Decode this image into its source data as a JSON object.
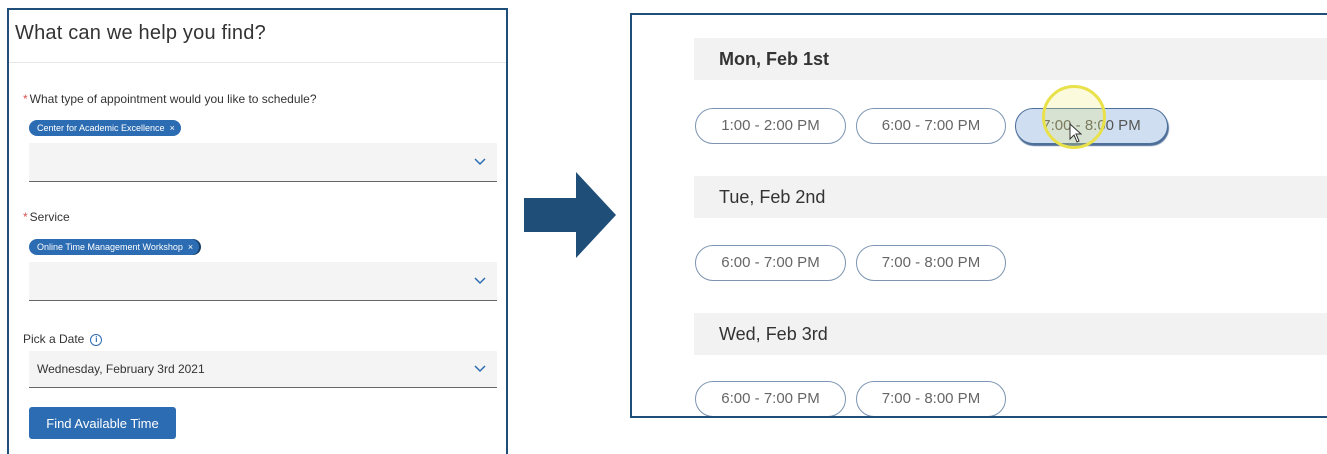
{
  "form": {
    "title": "What can we help you find?",
    "appointment_label": "What type of appointment would you like to schedule?",
    "appointment_chip": "Center for Academic Excellence",
    "service_label": "Service",
    "service_chip": "Online Time Management Workshop",
    "chip_remove": "×",
    "required_marker": "*",
    "date_label": "Pick a Date",
    "date_info_icon": "i",
    "date_value": "Wednesday, February 3rd 2021",
    "find_button": "Find Available Time"
  },
  "schedule": {
    "days": [
      {
        "label": "Mon, Feb 1st",
        "slots": [
          "1:00 - 2:00 PM",
          "6:00 - 7:00 PM",
          "7:00 - 8:00 PM"
        ]
      },
      {
        "label": "Tue, Feb 2nd",
        "slots": [
          "6:00 - 7:00 PM",
          "7:00 - 8:00 PM"
        ]
      },
      {
        "label": "Wed, Feb 3rd",
        "slots": [
          "6:00 - 7:00 PM",
          "7:00 - 8:00 PM"
        ]
      }
    ]
  },
  "colors": {
    "accent": "#2c6cb2",
    "border": "#1f4e79",
    "arrow": "#1f4e79",
    "highlight": "#e9e14a"
  }
}
